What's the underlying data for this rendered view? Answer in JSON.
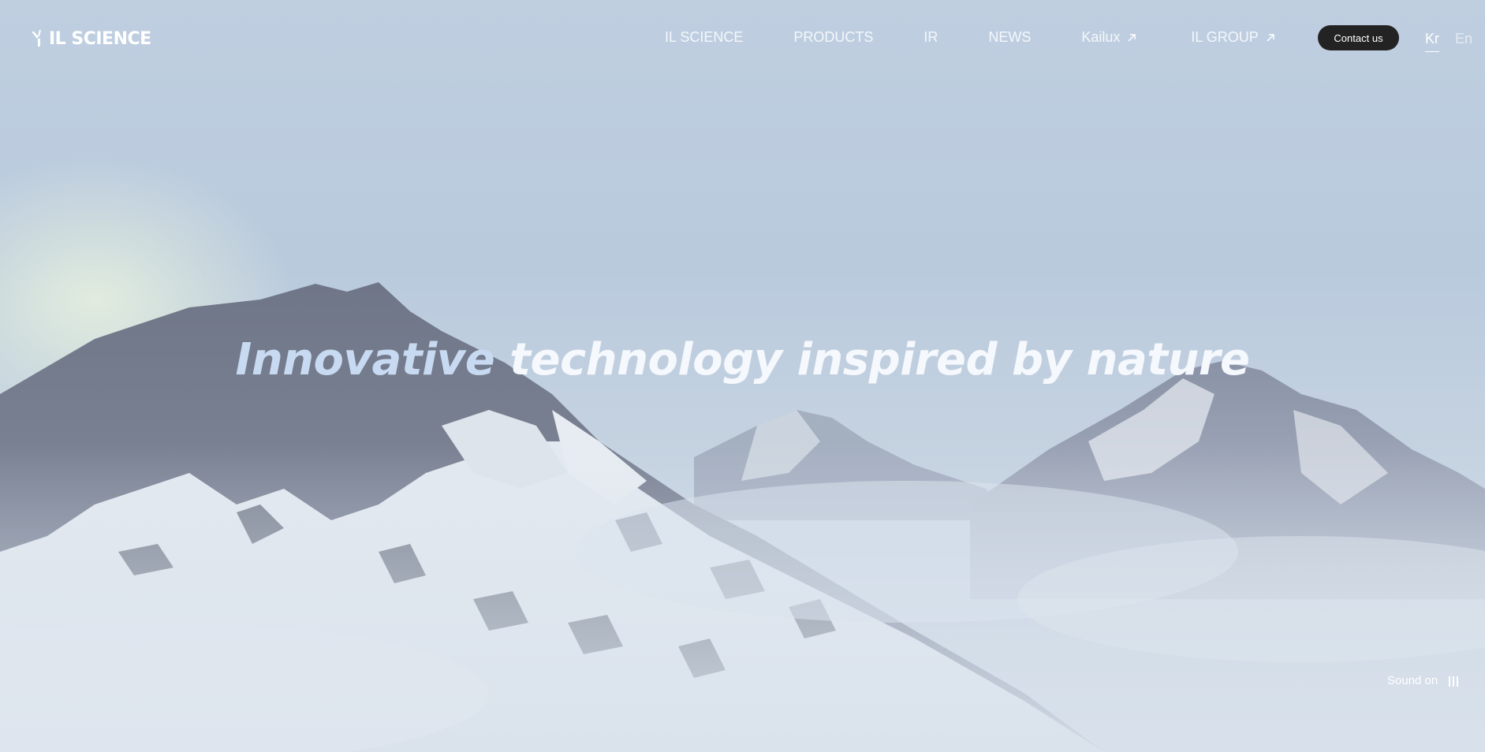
{
  "brand": {
    "name": "IL SCIENCE"
  },
  "nav": {
    "items": [
      {
        "label": "IL SCIENCE",
        "external": false
      },
      {
        "label": "PRODUCTS",
        "external": false
      },
      {
        "label": "IR",
        "external": false
      },
      {
        "label": "NEWS",
        "external": false
      },
      {
        "label": "Kailux",
        "external": true
      },
      {
        "label": "IL GROUP",
        "external": true
      }
    ],
    "contact_label": "Contact us"
  },
  "languages": {
    "kr": "Kr",
    "en": "En",
    "active": "Kr"
  },
  "hero": {
    "headline_part1": "Innovative",
    "headline_part2": " technology inspired by nature"
  },
  "sound": {
    "label": "Sound on"
  },
  "colors": {
    "contact_bg": "#232323",
    "sky": "#bfcfe0",
    "headline": "#f5f8fc"
  }
}
